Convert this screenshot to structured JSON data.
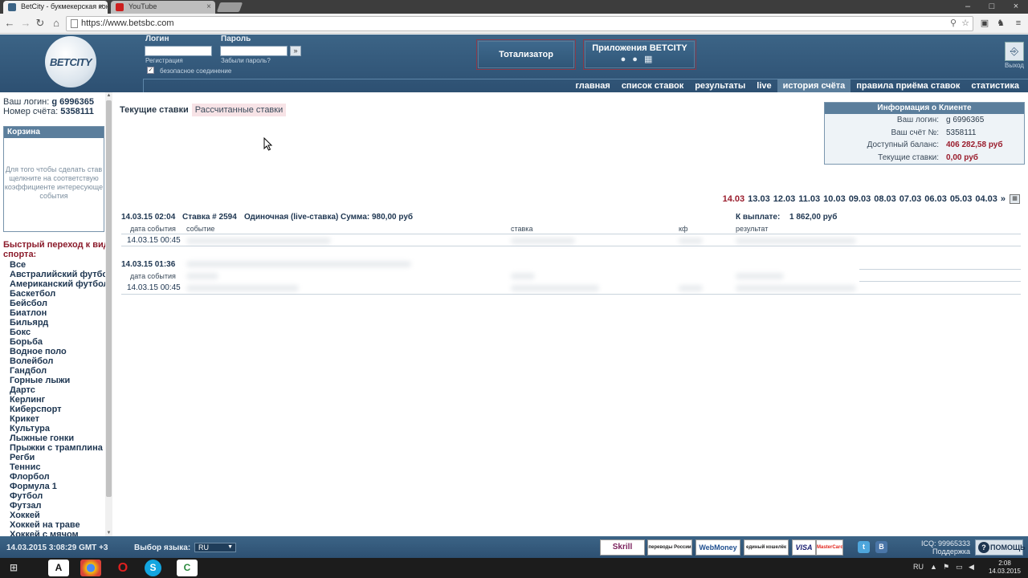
{
  "browser": {
    "tabs": [
      {
        "title": "BetCity - букмекерская кон"
      },
      {
        "title": "YouTube"
      }
    ],
    "url": "https://www.betsbc.com"
  },
  "header": {
    "logo_text": "BETCITY",
    "login_label": "Логин",
    "password_label": "Пароль",
    "register_link": "Регистрация",
    "forgot_link": "Забыли пароль?",
    "secure_label": "безопасное соединение",
    "go_symbol": "»",
    "totalizator_button": "Тотализатор",
    "apps_button": "Приложения BETCITY",
    "exit_label": "Выход",
    "nav": [
      {
        "label": "главная"
      },
      {
        "label": "список ставок"
      },
      {
        "label": "результаты"
      },
      {
        "label": "live"
      },
      {
        "label": "история счёта"
      },
      {
        "label": "правила приёма ставок"
      },
      {
        "label": "статистика"
      }
    ]
  },
  "left": {
    "login_label": "Ваш логин:",
    "login_value": "g 6996365",
    "account_label": "Номер счёта:",
    "account_value": "5358111",
    "basket_title": "Корзина",
    "basket_msg": [
      "Для того чтобы сделать став",
      "щелкните на соответствую",
      "коэффициенте интересующе",
      "события"
    ],
    "quick_title": [
      "Быстрый переход к вида",
      "спорта:"
    ],
    "sports": [
      "Все",
      "Австралийский футбол",
      "Американский футбол",
      "Баскетбол",
      "Бейсбол",
      "Биатлон",
      "Бильярд",
      "Бокс",
      "Борьба",
      "Водное поло",
      "Волейбол",
      "Гандбол",
      "Горные лыжи",
      "Дартс",
      "Керлинг",
      "Киберспорт",
      "Крикет",
      "Культура",
      "Лыжные гонки",
      "Прыжки с трамплина",
      "Регби",
      "Теннис",
      "Флорбол",
      "Формула 1",
      "Футбол",
      "Футзал",
      "Хоккей",
      "Хоккей на траве",
      "Хоккей с мячом"
    ]
  },
  "main": {
    "tabs": [
      {
        "label": "Текущие ставки"
      },
      {
        "label": "Рассчитанные ставки"
      }
    ],
    "client": {
      "title": "Информация о Клиенте",
      "rows": [
        {
          "k": "Ваш логин:",
          "v": "g 6996365"
        },
        {
          "k": "Ваш счёт №:",
          "v": "5358111"
        },
        {
          "k": "Доступный баланс:",
          "v": "406 282,58 руб"
        },
        {
          "k": "Текущие ставки:",
          "v": "0,00 руб"
        }
      ]
    },
    "dates": [
      "14.03",
      "13.03",
      "12.03",
      "11.03",
      "10.03",
      "09.03",
      "08.03",
      "07.03",
      "06.03",
      "05.03",
      "04.03",
      "»"
    ],
    "bet1": {
      "datetime": "14.03.15 02:04",
      "bet_no": "Ставка # 2594",
      "type": "Одиночная (live-ставка)",
      "sum": "Сумма: 980,00 руб",
      "payout_label": "К выплате:",
      "payout_value": "1 862,00 руб",
      "col_date": "дата события",
      "col_event": "событие",
      "col_bet": "ставка",
      "col_kf": "кф",
      "col_result": "результат",
      "row_date": "14.03.15 00:45"
    },
    "bet2": {
      "datetime": "14.03.15 01:36",
      "col_date": "дата события",
      "row_date": "14.03.15 00:45"
    }
  },
  "footer": {
    "datetime": "14.03.2015  3:08:29  GMT +3",
    "lang_label": "Выбор языка:",
    "lang_value": "RU",
    "payments": [
      "Skrill",
      "переводы России",
      "WebMoney",
      "единый кошелёк",
      "VISA",
      "MasterCard"
    ],
    "icq": "ICQ: 99965333",
    "support": "Поддержка",
    "help": "ПОМОЩЬ"
  },
  "taskbar": {
    "lang": "RU",
    "time": "2:08",
    "date": "14.03.2015"
  }
}
